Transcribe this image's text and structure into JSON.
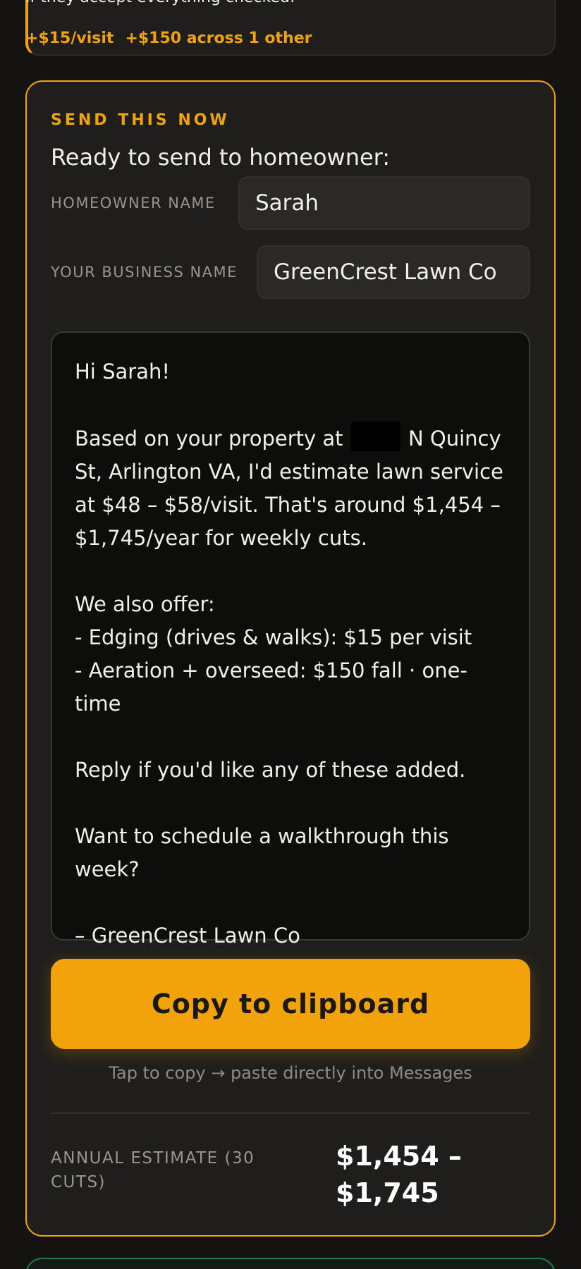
{
  "previous_card": {
    "line": "If they accept everything checked:",
    "chips": [
      "+$15/visit",
      "+$150 across 1 other"
    ]
  },
  "send_card": {
    "eyebrow": "SEND THIS NOW",
    "heading": "Ready to send to homeowner:",
    "homeowner_label": "HOMEOWNER NAME",
    "homeowner_value": "Sarah",
    "business_label": "YOUR BUSINESS NAME",
    "business_value": "GreenCrest Lawn Co",
    "message": {
      "greeting": "Hi Sarah!",
      "estimate_before": "Based on your property at",
      "estimate_after": "N Quincy St, Arlington VA, I'd estimate lawn service at $48 – $58/visit. That's around $1,454 – $1,745/year for weekly cuts.",
      "offer_intro": "We also offer:",
      "offer_1": "- Edging (drives & walks): $15 per visit",
      "offer_2": "- Aeration + overseed: $150 fall · one-time",
      "reply": "Reply if you'd like any of these added.",
      "schedule": "Want to schedule a walkthrough this week?",
      "signature": "– GreenCrest Lawn Co"
    },
    "copy_button": "Copy to clipboard",
    "hint": "Tap to copy → paste directly into Messages",
    "annual_label": "ANNUAL ESTIMATE (30 CUTS)",
    "annual_value": "$1,454 – $1,745"
  },
  "colors": {
    "accent": "#f2a20a",
    "background": "#141312",
    "card": "#1f1e1c",
    "next_card_border": "#1f7a47"
  }
}
